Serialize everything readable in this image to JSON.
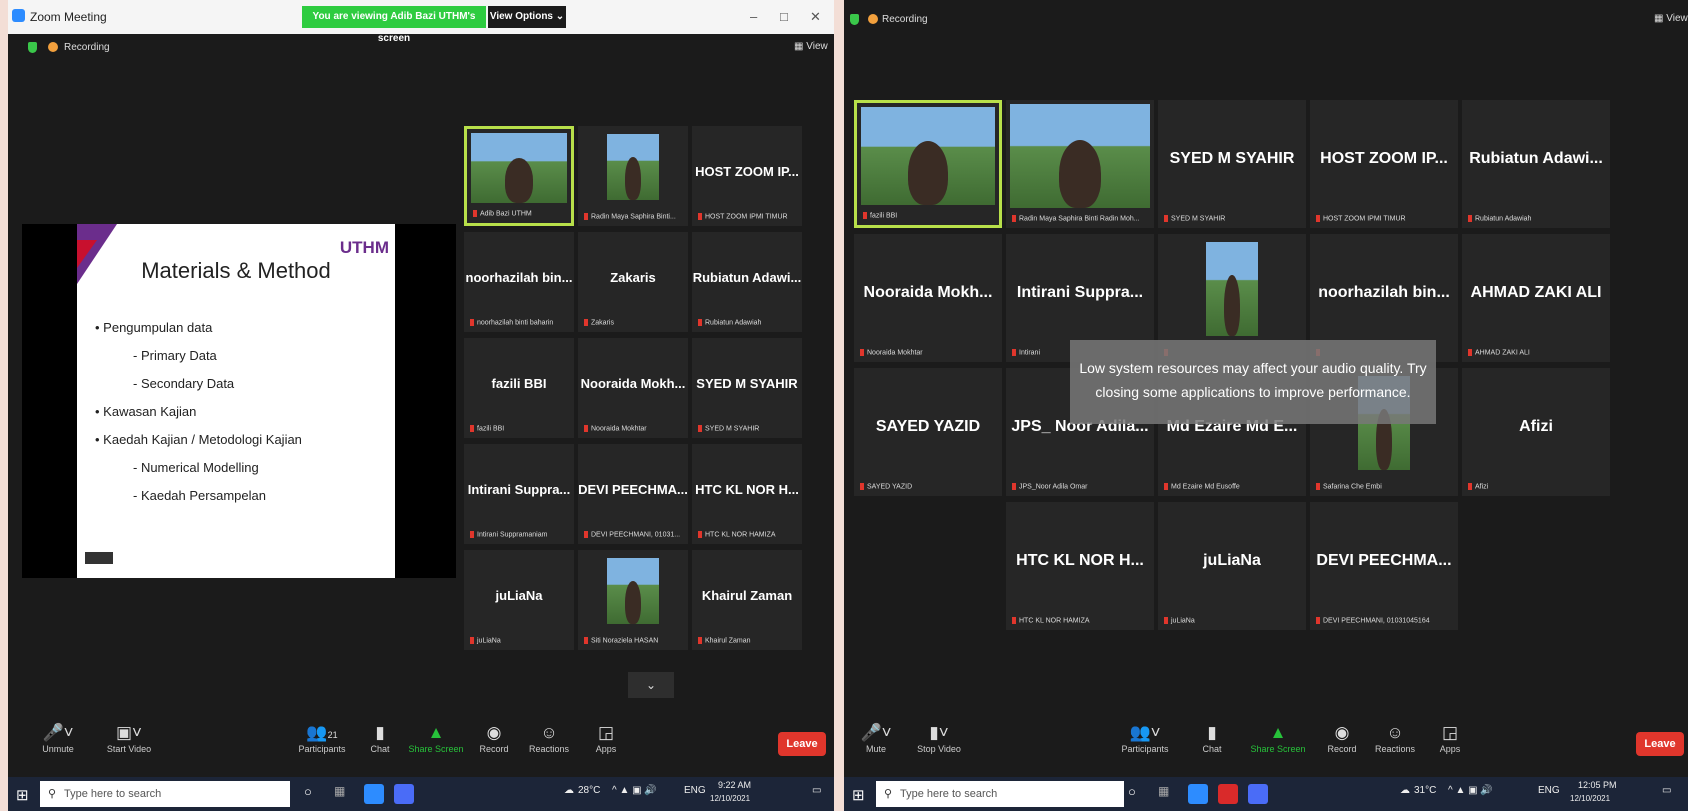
{
  "left_window": {
    "app_title": "Zoom Meeting",
    "viewing_banner": "You are viewing Adib Bazi UTHM's screen",
    "view_options": "View Options ⌄",
    "recording": "Recording",
    "view": "View",
    "slide": {
      "logo": "UTHM",
      "title": "Materials & Method",
      "bullets": [
        {
          "text": "•  Pengumpulan data",
          "level": 0
        },
        {
          "text": "- Primary Data",
          "level": 1
        },
        {
          "text": "- Secondary Data",
          "level": 1
        },
        {
          "text": "•  Kawasan Kajian",
          "level": 0
        },
        {
          "text": "•  Kaedah Kajian / Metodologi Kajian",
          "level": 0
        },
        {
          "text": "- Numerical Modelling",
          "level": 1
        },
        {
          "text": "- Kaedah Persampelan",
          "level": 1
        }
      ]
    },
    "tiles": [
      {
        "big": "",
        "small": "Adib Bazi UTHM",
        "video": true
      },
      {
        "big": "",
        "small": "Radin Maya Saphira Binti...",
        "video": true
      },
      {
        "big": "HOST ZOOM IP...",
        "small": "HOST ZOOM IPMI TIMUR"
      },
      {
        "big": "noorhazilah bin...",
        "small": "noorhazilah binti baharin"
      },
      {
        "big": "Zakaris",
        "small": "Zakaris"
      },
      {
        "big": "Rubiatun Adawi...",
        "small": "Rubiatun Adawiah"
      },
      {
        "big": "fazili BBI",
        "small": "fazili BBI"
      },
      {
        "big": "Nooraida Mokh...",
        "small": "Nooraida Mokhtar"
      },
      {
        "big": "SYED M SYAHIR",
        "small": "SYED M SYAHIR"
      },
      {
        "big": "Intirani Suppra...",
        "small": "Intirani Suppramaniam"
      },
      {
        "big": "DEVI PEECHMA...",
        "small": "DEVI PEECHMANI, 01031..."
      },
      {
        "big": "HTC KL NOR H...",
        "small": "HTC KL NOR HAMIZA"
      },
      {
        "big": "juLiaNa",
        "small": "juLiaNa"
      },
      {
        "big": "",
        "small": "Siti Noraziela HASAN",
        "video": true
      },
      {
        "big": "Khairul Zaman",
        "small": "Khairul Zaman"
      }
    ],
    "toolbar": {
      "unmute": "Unmute",
      "start_video": "Start Video",
      "participants": "Participants",
      "participants_count": "21",
      "chat": "Chat",
      "share_screen": "Share Screen",
      "record": "Record",
      "reactions": "Reactions",
      "apps": "Apps",
      "leave": "Leave"
    },
    "taskbar": {
      "search": "Type here to search",
      "weather": "28°C",
      "lang": "ENG",
      "time": "9:22 AM",
      "date": "12/10/2021"
    }
  },
  "right_window": {
    "recording": "Recording",
    "view": "View",
    "tiles": [
      {
        "big": "",
        "small": "fazili BBI",
        "video": true
      },
      {
        "big": "",
        "small": "Radin Maya Saphira Binti Radin Moh...",
        "video": true
      },
      {
        "big": "SYED M SYAHIR",
        "small": "SYED M SYAHIR"
      },
      {
        "big": "HOST ZOOM IP...",
        "small": "HOST ZOOM IPMI TIMUR"
      },
      {
        "big": "Rubiatun Adawi...",
        "small": "Rubiatun Adawiah"
      },
      {
        "big": "Nooraida Mokh...",
        "small": "Nooraida Mokhtar"
      },
      {
        "big": "Intirani Suppra...",
        "small": "Intirani"
      },
      {
        "big": "",
        "small": "",
        "video": true
      },
      {
        "big": "noorhazilah bin...",
        "small": ""
      },
      {
        "big": "AHMAD ZAKI ALI",
        "small": "AHMAD ZAKI ALI"
      },
      {
        "big": "SAYED YAZID",
        "small": "SAYED YAZID"
      },
      {
        "big": "JPS_ Noor Adila...",
        "small": "JPS_Noor Adila Omar"
      },
      {
        "big": "Md Ezaire Md E...",
        "small": "Md Ezaire Md Eusoffe"
      },
      {
        "big": "",
        "small": "Safarina Che Embi",
        "video": true
      },
      {
        "big": "Afizi",
        "small": "Afizi"
      },
      {
        "big": "HTC KL NOR H...",
        "small": "HTC KL NOR HAMIZA"
      },
      {
        "big": "juLiaNa",
        "small": "juLiaNa"
      },
      {
        "big": "DEVI PEECHMA...",
        "small": "DEVI PEECHMANI, 01031045164"
      }
    ],
    "toast": "Low system resources may affect your audio quality. Try closing some applications to improve performance.",
    "toolbar": {
      "mute": "Mute",
      "stop_video": "Stop Video",
      "participants": "Participants",
      "chat": "Chat",
      "share_screen": "Share Screen",
      "record": "Record",
      "reactions": "Reactions",
      "apps": "Apps",
      "leave": "Leave"
    },
    "taskbar": {
      "search": "Type here to search",
      "weather": "31°C",
      "lang": "ENG",
      "time": "12:05 PM",
      "date": "12/10/2021"
    }
  },
  "colors": {
    "zoom_bg": "#1b1b1b",
    "tile_bg": "#262626",
    "active_border": "#b8e04a",
    "leave_red": "#e0362c",
    "share_green": "#27c23a",
    "banner_green": "#2ecc40"
  }
}
